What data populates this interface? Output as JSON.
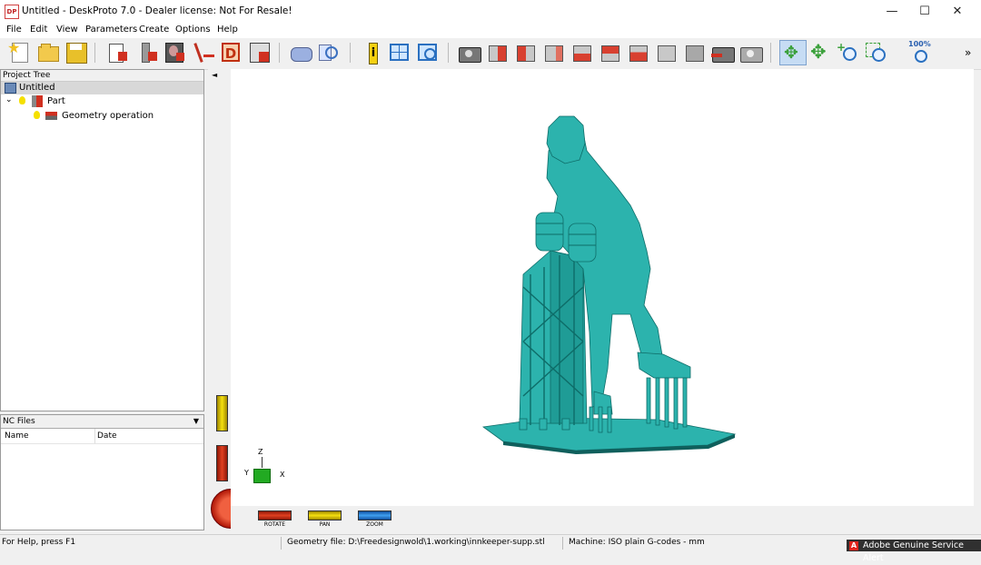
{
  "window": {
    "title": "Untitled - DeskProto 7.0 - Dealer license: Not For Resale!",
    "app_icon_text": "DP",
    "minimize": "—",
    "maximize": "☐",
    "close": "✕"
  },
  "menu": [
    "File",
    "Edit",
    "View",
    "Parameters",
    "Create",
    "Options",
    "Help"
  ],
  "toolbar": {
    "zoom_label": "100%",
    "more": "»",
    "icons": [
      "new-icon",
      "open-icon",
      "save-icon",
      "part-parameters-icon",
      "operation-parameters-icon",
      "bitmap-icon",
      "vector-icon",
      "drawing-icon",
      "save-nc-icon",
      "preview-icon",
      "search-view-icon",
      "info-icon",
      "layout-icon",
      "window-icon",
      "camera-icon",
      "view-front-icon",
      "view-back-icon",
      "view-left-icon",
      "view-right-icon",
      "view-top-icon",
      "view-bottom-icon",
      "view-iso-icon",
      "view-iso2-icon",
      "camera-rotate-icon",
      "camera-multi-icon",
      "rotate-mode-icon",
      "pan-mode-icon",
      "zoom-mode-icon",
      "zoom-window-icon",
      "zoom-100-icon"
    ]
  },
  "project_tree": {
    "header": "Project Tree",
    "root": "Untitled",
    "part": "Part",
    "operation": "Geometry operation"
  },
  "nc_files": {
    "header": "NC Files",
    "col_name": "Name",
    "col_date": "Date"
  },
  "viewport": {
    "axis_z": "Z",
    "axis_y": "Y",
    "axis_x": "X",
    "model_color": "#2cb3ad"
  },
  "controls": {
    "rotate": "ROTATE",
    "pan": "PAN",
    "zoom": "ZOOM",
    "collapse_arrow": "◄"
  },
  "status": {
    "help": "For Help, press F1",
    "geometry_file": "Geometry file: D:\\Freedesignwold\\1.working\\innkeeper-supp.stl",
    "machine": "Machine: ISO plain G-codes - mm"
  },
  "notification": {
    "text": "Adobe Genuine Service Alert",
    "icon_glyph": "A"
  }
}
